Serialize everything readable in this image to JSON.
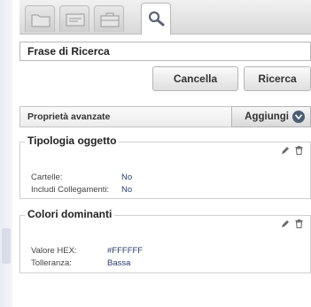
{
  "search": {
    "placeholder": "Frase di Ricerca",
    "cancel_label": "Cancella",
    "search_label": "Ricerca"
  },
  "tabs": [
    {
      "icon": "folder-icon"
    },
    {
      "icon": "card-icon"
    },
    {
      "icon": "briefcase-icon"
    },
    {
      "icon": "search-icon",
      "active": true
    }
  ],
  "advanced": {
    "title": "Proprietà avanzate",
    "add_label": "Aggiungi",
    "add_icon": "chevron-down-icon"
  },
  "object_type": {
    "legend": "Tipologia oggetto",
    "rows": [
      {
        "label": "Cartelle:",
        "value": "No"
      },
      {
        "label": "Includi Collegamenti:",
        "value": "No"
      }
    ]
  },
  "colors": {
    "legend": "Colori dominanti",
    "rows": [
      {
        "label": "Valore HEX:",
        "value": "#FFFFFF"
      },
      {
        "label": "Tolleranza:",
        "value": "Bassa"
      }
    ]
  },
  "palette": {
    "value_color": "#2a3a6c",
    "chevron_bg": "#4d5e73"
  }
}
